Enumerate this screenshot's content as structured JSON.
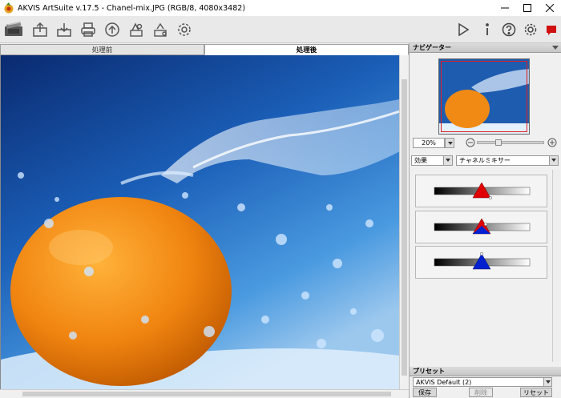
{
  "window": {
    "title": "AKVIS ArtSuite v.17.5 - Chanel-mix.JPG (RGB/8, 4080x3482)"
  },
  "tabs": {
    "before": "処理前",
    "after": "処理後"
  },
  "navigator": {
    "title": "ナビゲーター",
    "zoom": "20%"
  },
  "effect": {
    "label": "効果",
    "selected": "チャネルミキサー"
  },
  "preset": {
    "title": "プリセット",
    "selected": "AKVIS Default (2)",
    "save": "保存",
    "delete": "削除",
    "reset": "リセット"
  },
  "colors": {
    "red": "#e00000",
    "blue": "#0020d0"
  }
}
